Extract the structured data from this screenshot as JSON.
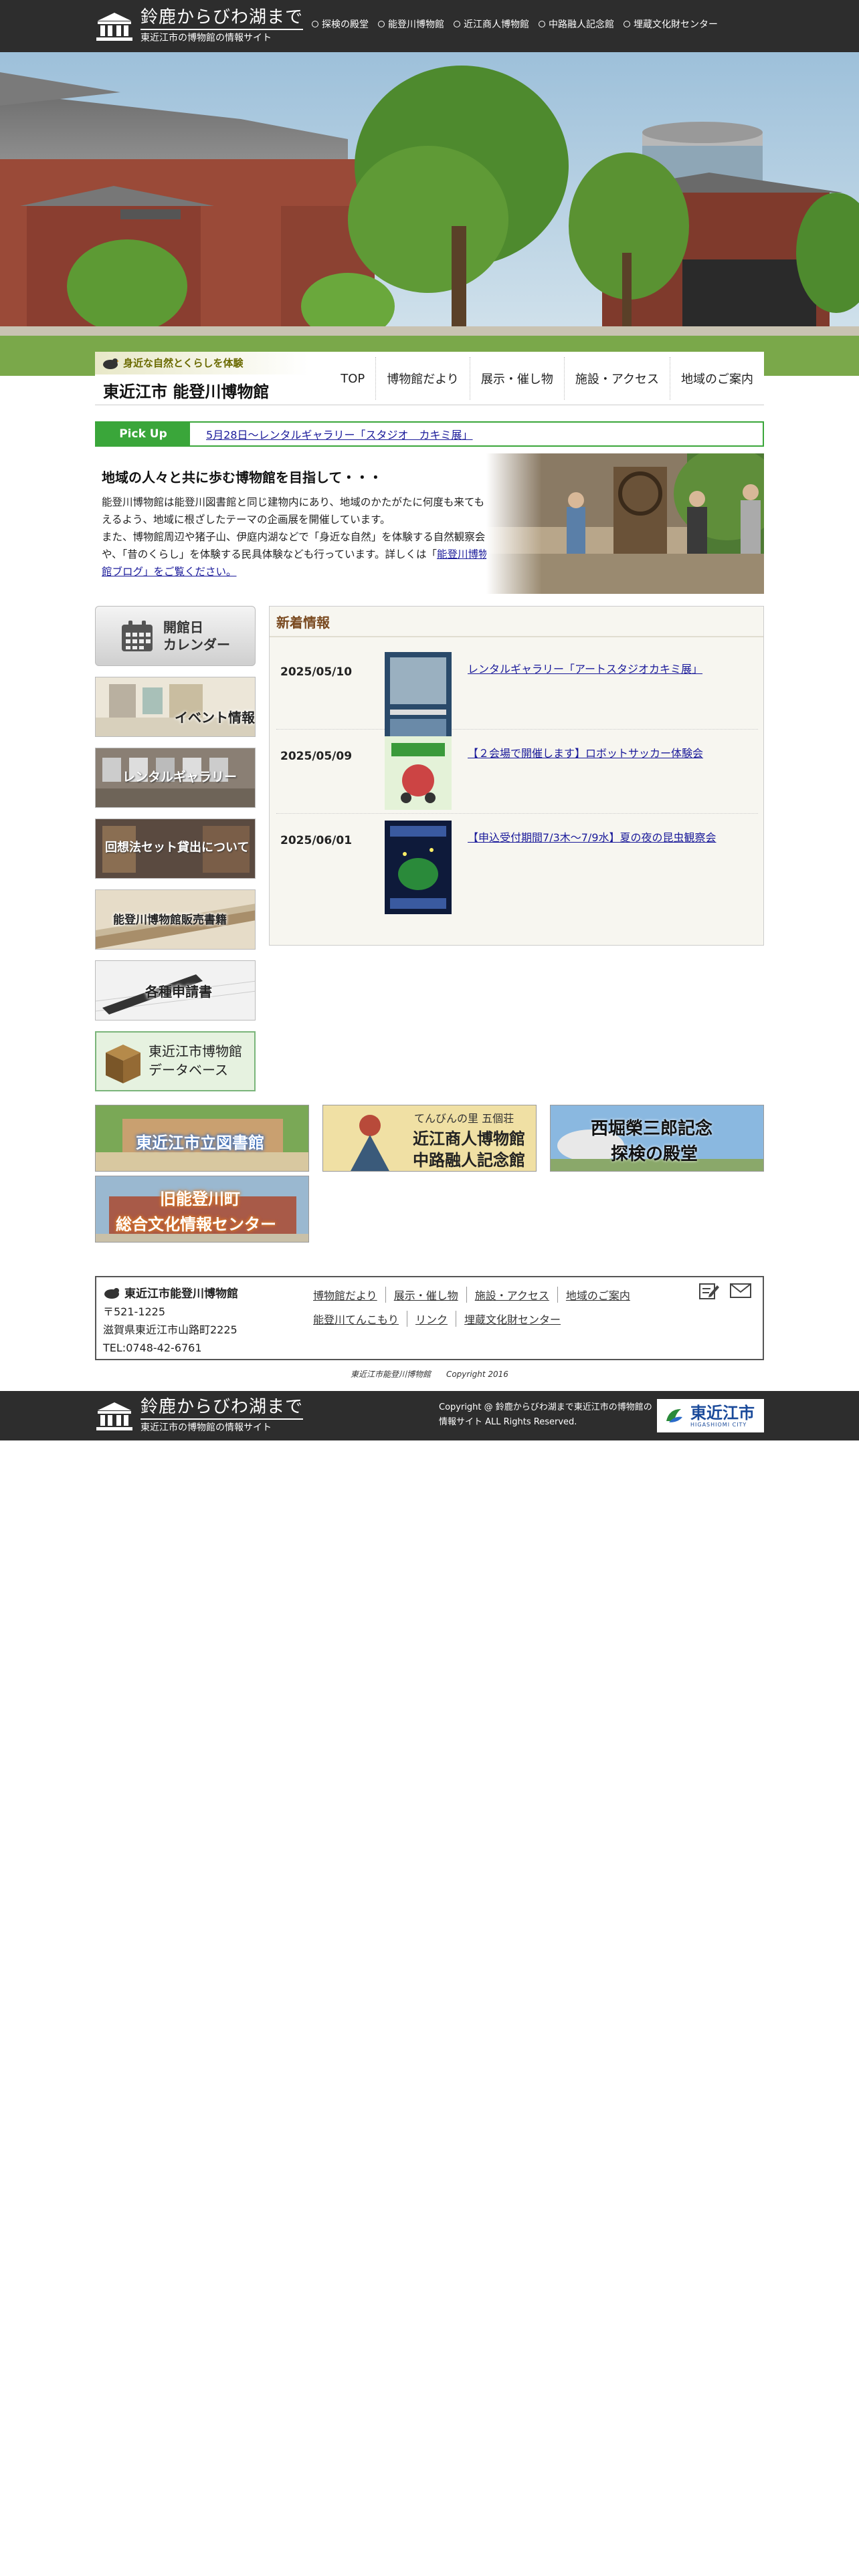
{
  "header": {
    "logo_title": "鈴鹿からびわ湖まで",
    "logo_sub": "東近江市の博物館の情報サイト",
    "nav": [
      {
        "label": "探検の殿堂"
      },
      {
        "label": "能登川博物館"
      },
      {
        "label": "近江商人博物館"
      },
      {
        "label": "中路融人記念館"
      },
      {
        "label": "埋蔵文化財センター"
      }
    ]
  },
  "site": {
    "tagline": "身近な自然とくらしを体験",
    "name": "東近江市 能登川博物館"
  },
  "main_nav": [
    {
      "label": "TOP"
    },
    {
      "label": "博物館だより"
    },
    {
      "label": "展示・催し物"
    },
    {
      "label": "施設・アクセス"
    },
    {
      "label": "地域のご案内"
    }
  ],
  "pickup": {
    "label": "Pick Up",
    "link": "5月28日〜レンタルギャラリー「スタジオ　カキミ展」"
  },
  "intro": {
    "title": "地域の人々と共に歩む博物館を目指して・・・",
    "text_1": "能登川博物館は能登川図書館と同じ建物内にあり、地域のかたがたに何度も来てもらえるよう、地域に根ざしたテーマの企画展を開催しています。",
    "text_2": "また、博物館周辺や猪子山、伊庭内湖などで「身近な自然」を体験する自然観察会や、「昔のくらし」を体験する民具体験なども行っています。詳しくは「",
    "text_link": "能登川博物館ブログ」をご覧ください。"
  },
  "sidebar": {
    "calendar_line1": "開館日",
    "calendar_line2": "カレンダー",
    "event": "イベント情報",
    "rental": "レンタルギャラリー",
    "loan": "回想法セット貸出について",
    "books": "能登川博物館販売書籍",
    "forms": "各種申請書",
    "db_line1": "東近江市博物館",
    "db_line2": "データベース"
  },
  "news": {
    "title": "新着情報",
    "items": [
      {
        "date": "2025/05/10",
        "title": "レンタルギャラリー「アートスタジオカキミ展」"
      },
      {
        "date": "2025/05/09",
        "title": "【２会場で開催します】ロボットサッカー体験会"
      },
      {
        "date": "2025/06/01",
        "title": "【申込受付期間7/3木〜7/9水】夏の夜の昆虫観察会"
      }
    ]
  },
  "banners": {
    "library": "東近江市立図書館",
    "merchant_top": "てんびんの里 五個荘",
    "merchant_line1": "近江商人博物館",
    "merchant_line2": "中路融人記念館",
    "nishibori_line1": "西堀榮三郎記念",
    "nishibori_line2": "探検の殿堂",
    "bunka_line1": "旧能登川町",
    "bunka_line2": "総合文化情報センター"
  },
  "footer": {
    "name": "東近江市能登川博物館",
    "postal": "〒521-1225",
    "address": "滋賀県東近江市山路町2225",
    "tel": "TEL:0748-42-6761",
    "links_row1": [
      "博物館だより",
      "展示・催し物",
      "施設・アクセス",
      "地域のご案内"
    ],
    "links_row2": [
      "能登川てんこもり",
      "リンク",
      "埋蔵文化財センター"
    ],
    "copy_name": "東近江市能登川博物館",
    "copy_year": "Copyright 2016"
  },
  "bottom": {
    "copy_line1": "Copyright @ 鈴鹿からびわ湖まで東近江市の博物館の",
    "copy_line2": "情報サイト ALL Rights Reserved.",
    "city_name": "東近江市",
    "city_en": "HIGASHIOMI CITY"
  },
  "colors": {
    "header_bg": "#2d2d2d",
    "pickup_green": "#3aa63a",
    "news_title": "#7a4a20",
    "link": "#1a1a9a"
  }
}
